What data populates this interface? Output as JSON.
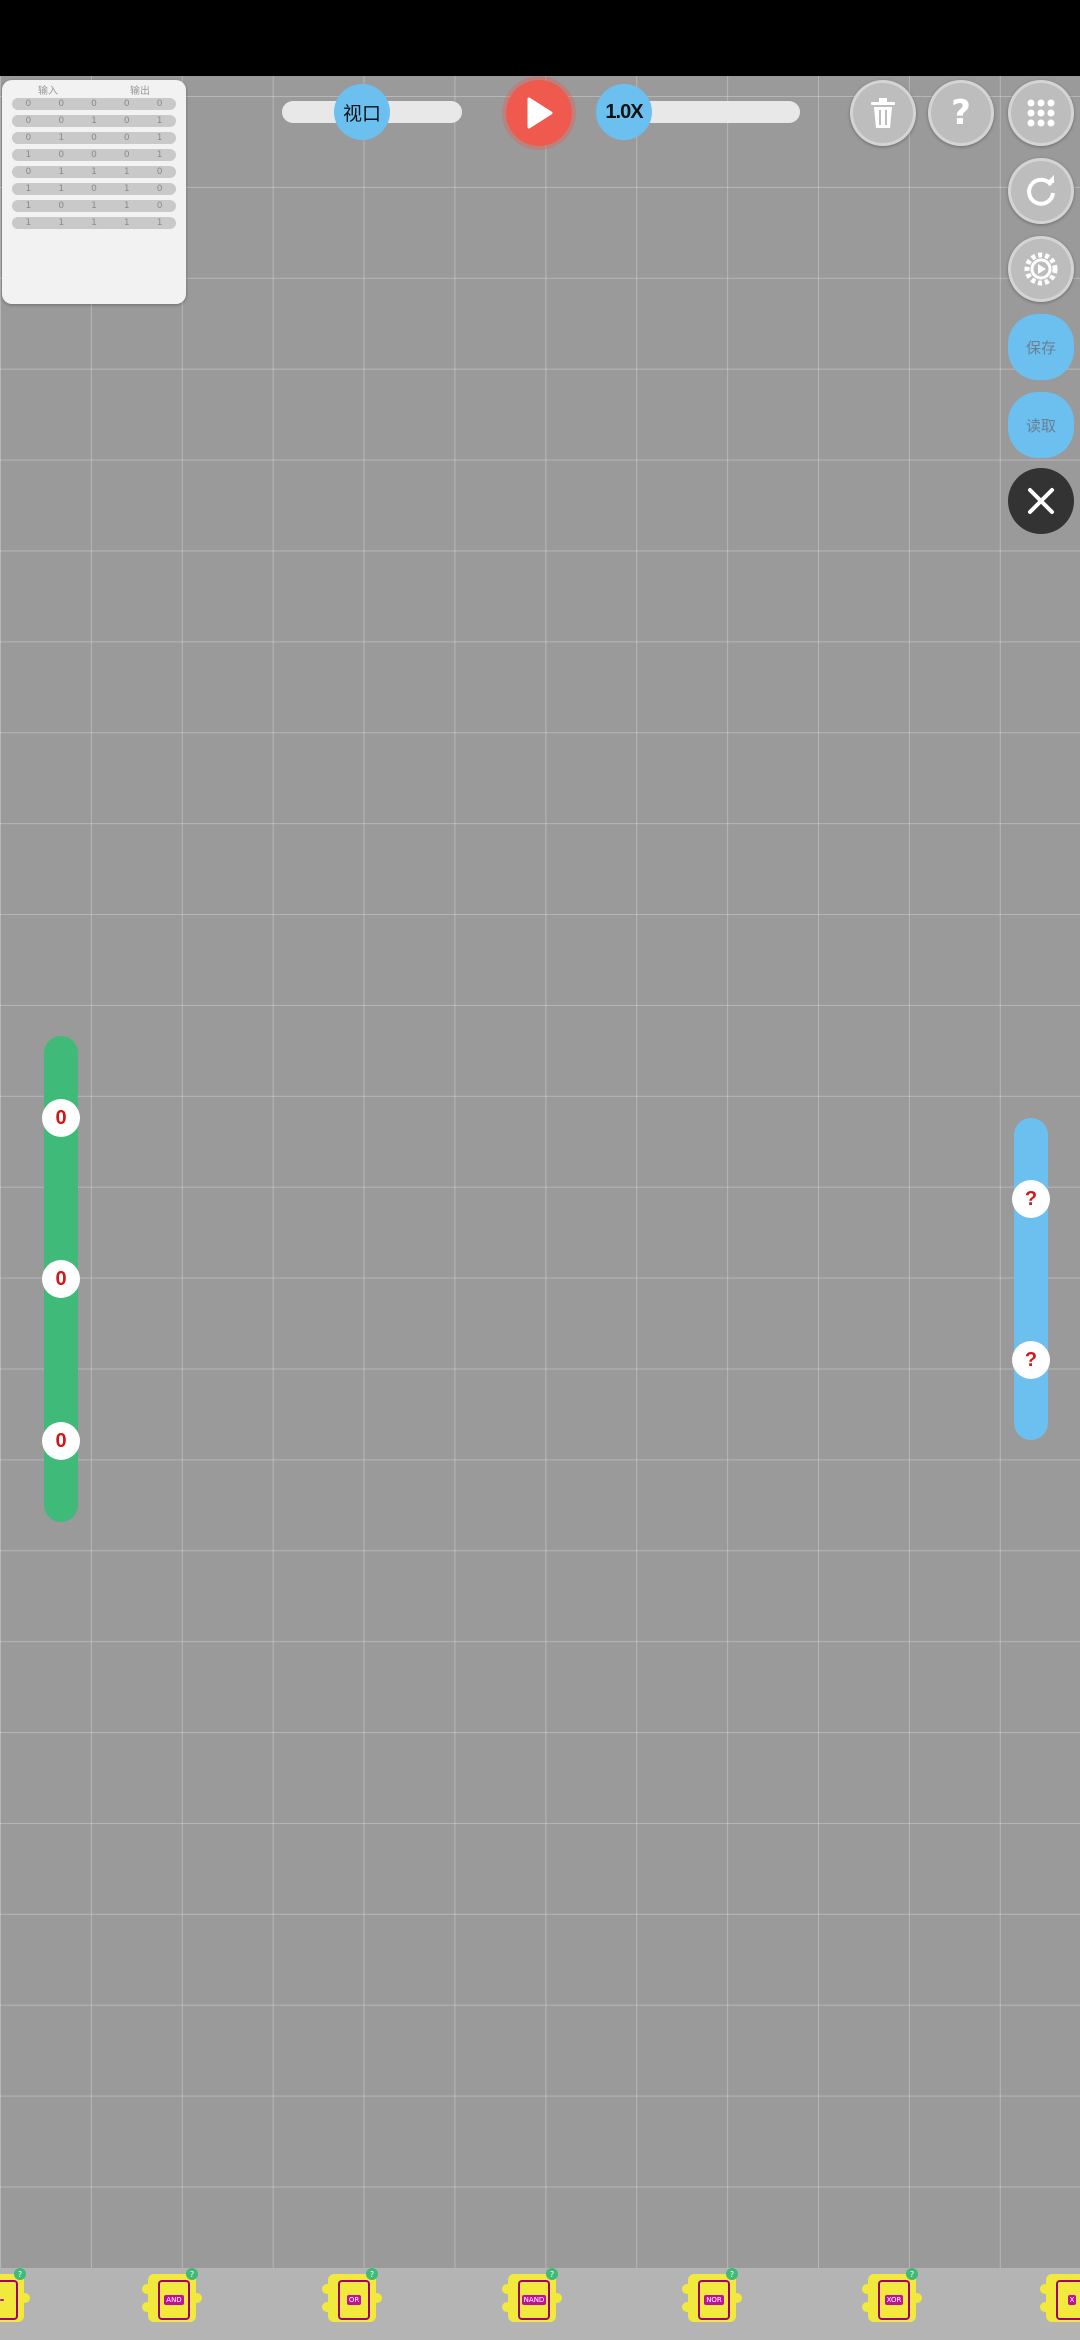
{
  "truth_table": {
    "headers": [
      "输入",
      "输出"
    ],
    "rows": [
      [
        "0",
        "0",
        "0",
        "0",
        "0"
      ],
      [
        "0",
        "0",
        "1",
        "0",
        "1"
      ],
      [
        "0",
        "1",
        "0",
        "0",
        "1"
      ],
      [
        "1",
        "0",
        "0",
        "0",
        "1"
      ],
      [
        "0",
        "1",
        "1",
        "1",
        "0"
      ],
      [
        "1",
        "1",
        "0",
        "1",
        "0"
      ],
      [
        "1",
        "0",
        "1",
        "1",
        "0"
      ],
      [
        "1",
        "1",
        "1",
        "1",
        "1"
      ]
    ]
  },
  "viewport_slider": {
    "label": "视口"
  },
  "speed_slider": {
    "label": "1.0X"
  },
  "side_buttons": {
    "save_label": "保存",
    "load_label": "读取"
  },
  "inputs": {
    "values": [
      "0",
      "0",
      "0"
    ]
  },
  "outputs": {
    "values": [
      "?",
      "?"
    ]
  },
  "toolbox": {
    "gates": [
      "",
      "AND",
      "OR",
      "NAND",
      "NOR",
      "XOR",
      "X"
    ]
  },
  "colors": {
    "input_bar": "#3fba78",
    "output_bar": "#6cc0f0",
    "play": "#f05a4e",
    "gate": "#f1ea3c"
  }
}
